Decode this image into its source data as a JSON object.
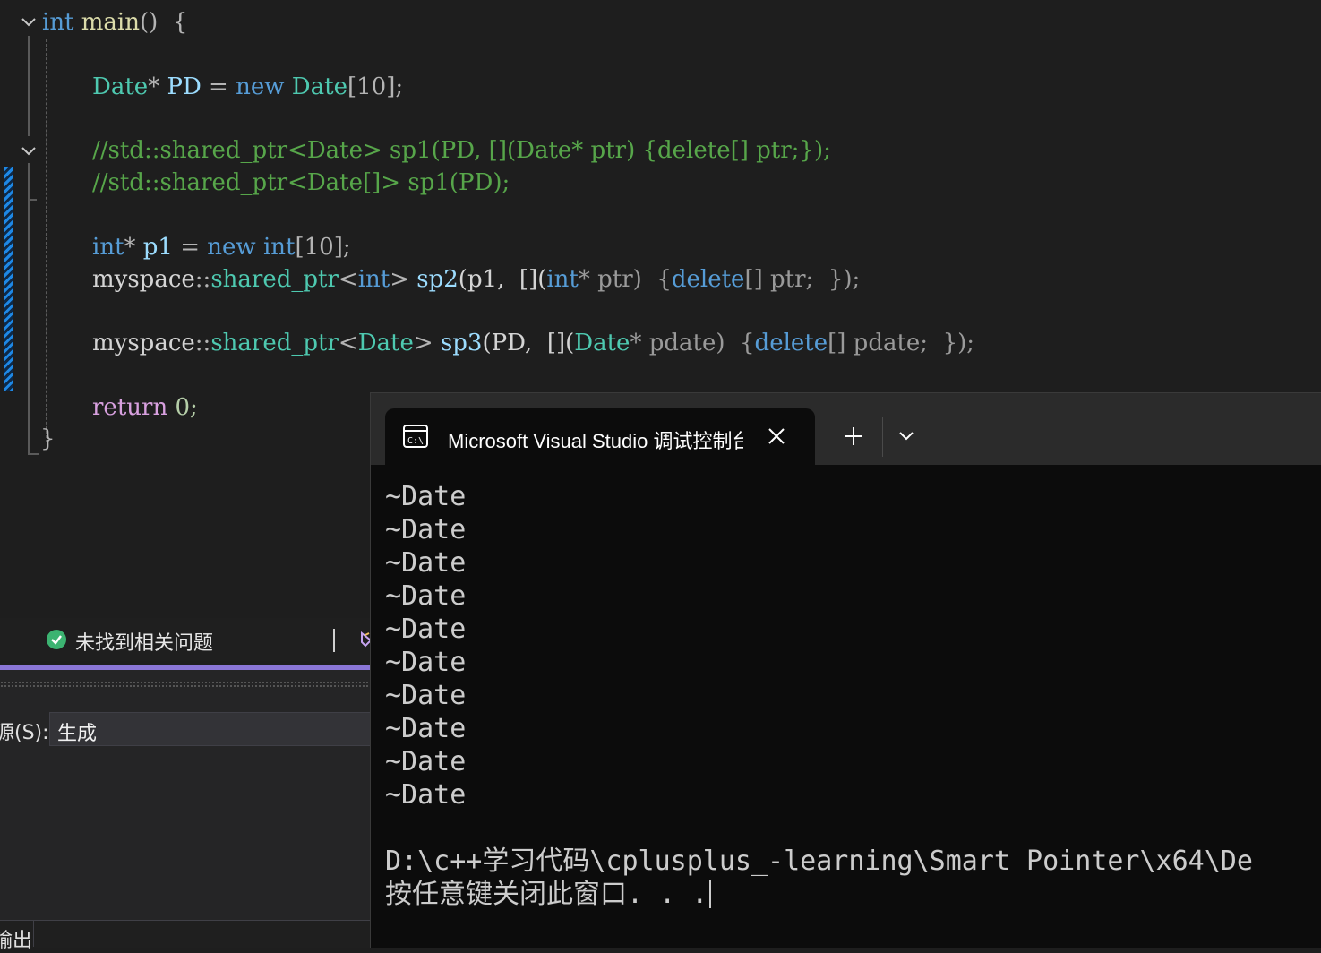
{
  "editor": {
    "lines": {
      "l1": {
        "kw": "int",
        "fn": "main",
        "rest": "()  {"
      },
      "l3": {
        "ty1": "Date",
        "op1": "* ",
        "var": "PD",
        "op2": " = ",
        "kw": "new",
        "ty2": "Date",
        "rest": "[10];"
      },
      "l5": {
        "text": "//std::shared_ptr<Date> sp1(PD, [](Date* ptr) {delete[] ptr;});"
      },
      "l6": {
        "text": "//std::shared_ptr<Date[]> sp1(PD);"
      },
      "l8": {
        "kw1": "int",
        "op1": "* ",
        "var": "p1",
        "op2": " = ",
        "kw2": "new",
        "kw3": "int",
        "rest": "[10];"
      },
      "l9": {
        "ns": "myspace",
        "op1": "::",
        "ty": "shared_ptr",
        "op2": "<",
        "kw1": "int",
        "op3": "> ",
        "var": "sp2",
        "p1": "(p1,  [](",
        "kw2": "int",
        "p2": "* ptr)  {",
        "kw3": "delete",
        "p3": "[] ptr;  });"
      },
      "l11": {
        "ns": "myspace",
        "op1": "::",
        "ty": "shared_ptr",
        "op2": "<",
        "ty2": "Date",
        "op3": "> ",
        "var": "sp3",
        "p1": "(PD,  [](",
        "ty3": "Date",
        "p2": "* pdate)  {",
        "kw": "delete",
        "p3": "[] pdate;  });"
      },
      "l13": {
        "ctl": "return",
        "rest": " 0;"
      },
      "l14": {
        "text": "}"
      }
    }
  },
  "status": {
    "message": "未找到相关问题"
  },
  "output_panel": {
    "source_label": "源(S):",
    "source_value": "生成",
    "tab_label": "输出"
  },
  "console": {
    "tab_title": "Microsoft Visual Studio 调试控制台",
    "lines": [
      "~Date",
      "~Date",
      "~Date",
      "~Date",
      "~Date",
      "~Date",
      "~Date",
      "~Date",
      "~Date",
      "~Date"
    ],
    "path_line": "D:\\c++学习代码\\cplusplus_-learning\\Smart Pointer\\x64\\De",
    "prompt_line": "按任意键关闭此窗口. . ."
  }
}
